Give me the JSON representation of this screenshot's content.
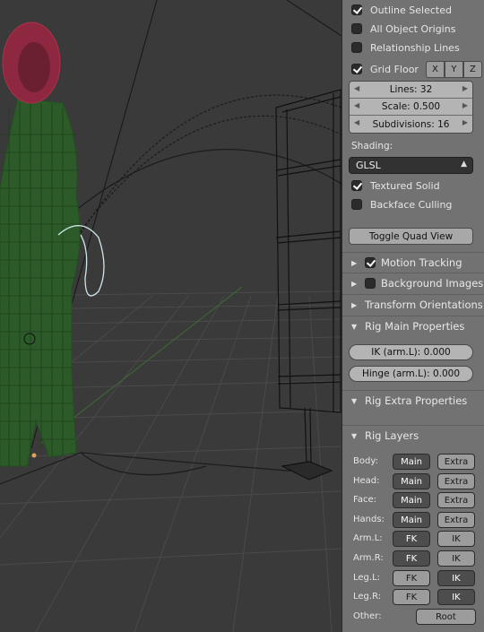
{
  "viewport": {
    "floor_grid": true,
    "objects": [
      "character-mesh",
      "shelf-mesh",
      "rig-curves"
    ]
  },
  "display": {
    "outline_selected": {
      "label": "Outline Selected",
      "checked": true
    },
    "all_object_origins": {
      "label": "All Object Origins",
      "checked": false
    },
    "relationship_lines": {
      "label": "Relationship Lines",
      "checked": false
    },
    "grid_floor": {
      "label": "Grid Floor",
      "checked": true
    },
    "axes": [
      "X",
      "Y",
      "Z"
    ],
    "lines": "Lines: 32",
    "scale": "Scale: 0.500",
    "subdivisions": "Subdivisions: 16"
  },
  "shading": {
    "label": "Shading:",
    "value": "GLSL",
    "textured_solid": {
      "label": "Textured Solid",
      "checked": true
    },
    "backface_culling": {
      "label": "Backface Culling",
      "checked": false
    }
  },
  "toggle_quad_view": "Toggle Quad View",
  "sections": {
    "motion_tracking": {
      "label": "Motion Tracking",
      "checked": true,
      "expanded": false
    },
    "background_images": {
      "label": "Background Images",
      "checked": false,
      "expanded": false
    },
    "transform_orientations": {
      "label": "Transform Orientations",
      "expanded": false
    },
    "rig_main_properties": {
      "label": "Rig Main Properties",
      "expanded": true
    },
    "rig_extra_properties": {
      "label": "Rig Extra Properties",
      "expanded": true
    },
    "rig_layers": {
      "label": "Rig Layers",
      "expanded": true
    }
  },
  "rig_main": {
    "ik_arm_l": "IK (arm.L): 0.000",
    "hinge_arm_l": "Hinge (arm.L): 0.000"
  },
  "rig_layers": [
    {
      "label": "Body:",
      "a": "Main",
      "b": "Extra",
      "a_on": true,
      "b_on": false
    },
    {
      "label": "Head:",
      "a": "Main",
      "b": "Extra",
      "a_on": true,
      "b_on": false
    },
    {
      "label": "Face:",
      "a": "Main",
      "b": "Extra",
      "a_on": true,
      "b_on": false
    },
    {
      "label": "Hands:",
      "a": "Main",
      "b": "Extra",
      "a_on": true,
      "b_on": false
    },
    {
      "label": "Arm.L:",
      "a": "FK",
      "b": "IK",
      "a_on": true,
      "b_on": false
    },
    {
      "label": "Arm.R:",
      "a": "FK",
      "b": "IK",
      "a_on": true,
      "b_on": false
    },
    {
      "label": "Leg.L:",
      "a": "FK",
      "b": "IK",
      "a_on": false,
      "b_on": true
    },
    {
      "label": "Leg.R:",
      "a": "FK",
      "b": "IK",
      "a_on": false,
      "b_on": true
    }
  ],
  "rig_layers_other": {
    "label": "Other:",
    "button": "Root"
  },
  "colors": {
    "panel_bg": "#727272",
    "viewport_bg": "#3a3a3a",
    "mesh_green": "#2f6b2a",
    "hair_red": "#b0304a",
    "button_on": "#4d4d4d",
    "button_off": "#9c9c9c"
  }
}
